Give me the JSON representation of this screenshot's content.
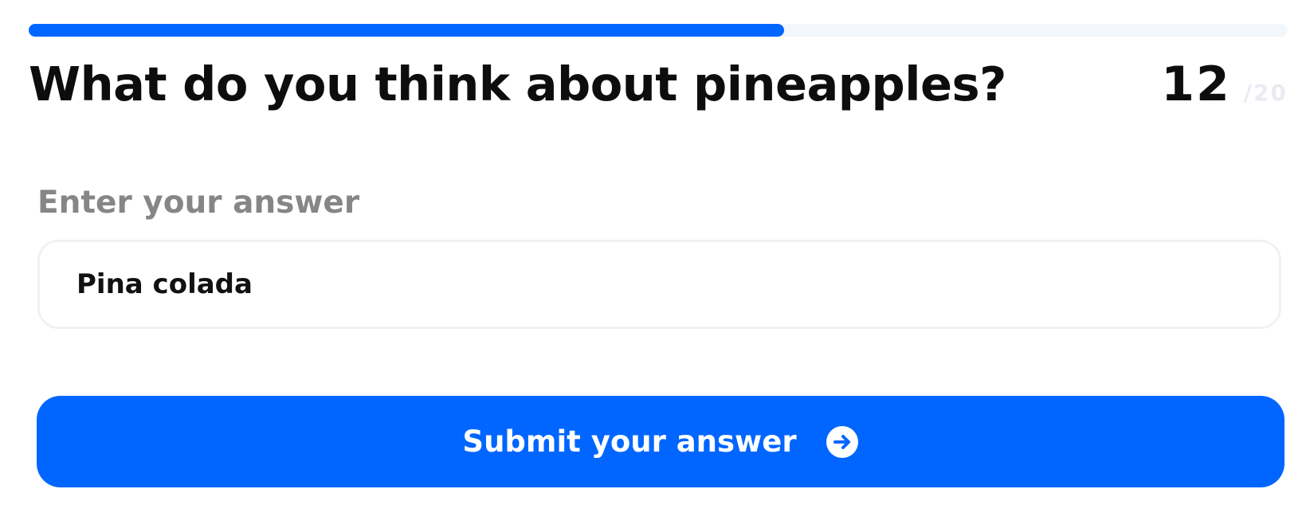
{
  "progress": {
    "fraction": 0.6,
    "fill_color": "#0066ff",
    "track_color": "#f3f6fb"
  },
  "question": {
    "text": "What do you think about pineapples?"
  },
  "counter": {
    "current": "12",
    "total": "/20"
  },
  "answer": {
    "label": "Enter your answer",
    "value": "Pina colada"
  },
  "submit": {
    "label": "Submit your answer",
    "icon": "arrow-right-circle-icon",
    "color": "#0066ff"
  }
}
